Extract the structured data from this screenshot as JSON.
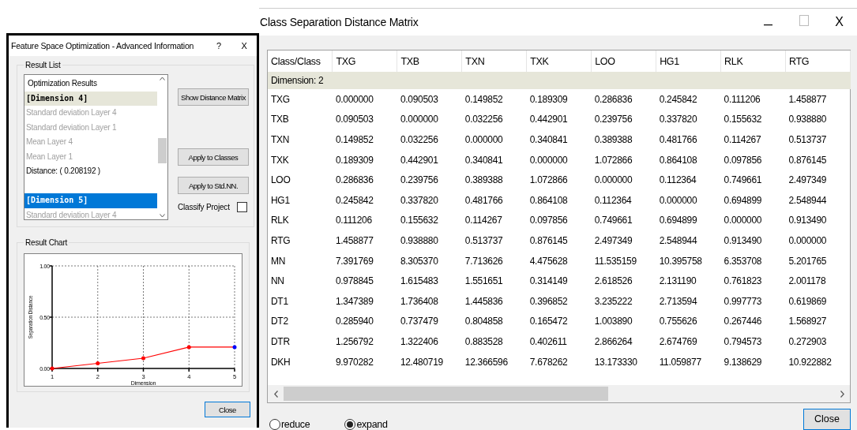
{
  "feature_dialog": {
    "title": "Feature Space Optimization - Advanced Information",
    "help_button": "?",
    "close_glyph": "X",
    "result_list": {
      "label": "Result List",
      "items": [
        {
          "kind": "header",
          "text": "Optimization Results",
          "selected": false,
          "marked": false
        },
        {
          "kind": "dimension",
          "text": "[Dimension 4]",
          "selected": false,
          "marked": true
        },
        {
          "kind": "feature",
          "text": "Standard deviation Layer 4",
          "selected": false,
          "marked": false
        },
        {
          "kind": "feature",
          "text": "Standard deviation Layer 1",
          "selected": false,
          "marked": false
        },
        {
          "kind": "feature",
          "text": "Mean Layer 4",
          "selected": false,
          "marked": false
        },
        {
          "kind": "feature",
          "text": "Mean Layer 1",
          "selected": false,
          "marked": false
        },
        {
          "kind": "distance",
          "text": "Distance: ( 0.208192 )",
          "selected": false,
          "marked": false
        },
        {
          "kind": "dimension",
          "text": "[Dimension 5]",
          "selected": true,
          "marked": false
        },
        {
          "kind": "feature",
          "text": "Standard deviation Layer 4",
          "selected": false,
          "marked": false
        }
      ],
      "buttons": [
        "Show Distance Matrix",
        "Apply to Classes",
        "Apply to Std.NN."
      ],
      "classify_project": {
        "label": "Classify Project",
        "checked": false
      }
    },
    "result_chart": {
      "label": "Result Chart",
      "chart_data": {
        "type": "line",
        "xlabel": "Dimension",
        "ylabel": "Separation Distance",
        "x": [
          1,
          2,
          3,
          4,
          5
        ],
        "series": [
          {
            "color": "#ff0000",
            "values": [
              0.0,
              0.05,
              0.1,
              0.208,
              0.208
            ]
          }
        ],
        "grid": true,
        "xlim": [
          1,
          5
        ],
        "ylim": [
          0,
          1
        ],
        "xticks": [
          1,
          2,
          3,
          4,
          5
        ],
        "yticks": [
          {
            "value": 0,
            "label": "0.00"
          },
          {
            "value": 0.5,
            "label": "0.50"
          },
          {
            "value": 1,
            "label": "1.00"
          }
        ]
      },
      "points": [
        {
          "selected": false
        },
        {
          "selected": false
        },
        {
          "selected": false
        },
        {
          "selected": false
        },
        {
          "selected": true
        }
      ]
    },
    "close_button": "Close"
  },
  "matrix_window": {
    "title": "Class Separation Distance Matrix",
    "close_glyph": "X",
    "table": {
      "columns": [
        "Class/Class",
        "TXG",
        "TXB",
        "TXN",
        "TXK",
        "LOO",
        "HG1",
        "RLK",
        "RTG"
      ],
      "group": "Dimension: 2",
      "rows": [
        [
          "TXG",
          "0.000000",
          "0.090503",
          "0.149852",
          "0.189309",
          "0.286836",
          "0.245842",
          "0.111206",
          "1.458877"
        ],
        [
          "TXB",
          "0.090503",
          "0.000000",
          "0.032256",
          "0.442901",
          "0.239756",
          "0.337820",
          "0.155632",
          "0.938880"
        ],
        [
          "TXN",
          "0.149852",
          "0.032256",
          "0.000000",
          "0.340841",
          "0.389388",
          "0.481766",
          "0.114267",
          "0.513737"
        ],
        [
          "TXK",
          "0.189309",
          "0.442901",
          "0.340841",
          "0.000000",
          "1.072866",
          "0.864108",
          "0.097856",
          "0.876145"
        ],
        [
          "LOO",
          "0.286836",
          "0.239756",
          "0.389388",
          "1.072866",
          "0.000000",
          "0.112364",
          "0.749661",
          "2.497349"
        ],
        [
          "HG1",
          "0.245842",
          "0.337820",
          "0.481766",
          "0.864108",
          "0.112364",
          "0.000000",
          "0.694899",
          "2.548944"
        ],
        [
          "RLK",
          "0.111206",
          "0.155632",
          "0.114267",
          "0.097856",
          "0.749661",
          "0.694899",
          "0.000000",
          "0.913490"
        ],
        [
          "RTG",
          "1.458877",
          "0.938880",
          "0.513737",
          "0.876145",
          "2.497349",
          "2.548944",
          "0.913490",
          "0.000000"
        ],
        [
          "MN",
          "7.391769",
          "8.305370",
          "7.713626",
          "4.475628",
          "11.535159",
          "10.395758",
          "6.353708",
          "5.201765"
        ],
        [
          "NN",
          "0.978845",
          "1.615483",
          "1.551651",
          "0.314149",
          "2.618526",
          "2.131190",
          "0.761823",
          "2.001178"
        ],
        [
          "DT1",
          "1.347389",
          "1.736408",
          "1.445836",
          "0.396852",
          "3.235222",
          "2.713594",
          "0.997773",
          "0.619869"
        ],
        [
          "DT2",
          "0.285940",
          "0.737479",
          "0.804858",
          "0.165472",
          "1.003890",
          "0.755626",
          "0.267446",
          "1.568927"
        ],
        [
          "DTR",
          "1.256792",
          "1.322406",
          "0.883528",
          "0.402611",
          "2.866264",
          "2.674769",
          "0.794573",
          "0.272903"
        ],
        [
          "DKH",
          "9.970282",
          "12.480719",
          "12.366596",
          "7.678262",
          "13.173330",
          "11.059877",
          "9.138629",
          "10.922882"
        ]
      ]
    },
    "options": [
      {
        "label": "reduce",
        "selected": false
      },
      {
        "label": "expand",
        "selected": true
      }
    ],
    "close_button": "Close"
  }
}
